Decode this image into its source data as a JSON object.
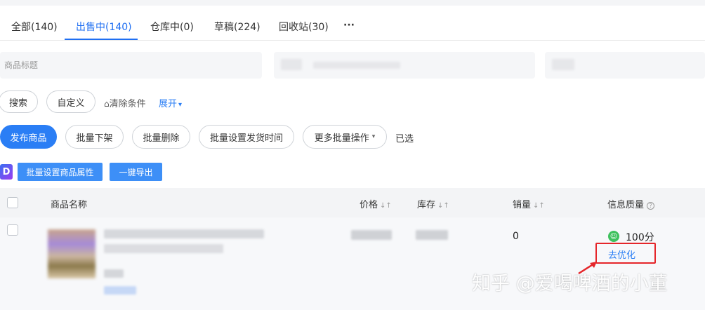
{
  "tabs": [
    {
      "label": "全部(140)"
    },
    {
      "label": "出售中(140)"
    },
    {
      "label": "仓库中(0)"
    },
    {
      "label": "草稿(224)"
    },
    {
      "label": "回收站(30)"
    },
    {
      "label": "···"
    }
  ],
  "filters": {
    "title_placeholder": "商品标题"
  },
  "search_row": {
    "search_label": "搜索",
    "custom_label": "自定义",
    "clear_label": "清除条件",
    "expand_label": "展开"
  },
  "actions": {
    "publish_label": "发布商品",
    "batch_delist_label": "批量下架",
    "batch_delete_label": "批量删除",
    "batch_ship_time_label": "批量设置发货时间",
    "more_batch_label": "更多批量操作",
    "selected_label": "已选"
  },
  "tools": {
    "logo_letter": "D",
    "batch_attr_label": "批量设置商品属性",
    "export_label": "一键导出"
  },
  "table": {
    "columns": {
      "name": "商品名称",
      "price": "价格",
      "stock": "库存",
      "sales": "销量",
      "quality": "信息质量"
    },
    "rows": [
      {
        "sales": "0",
        "score": "100分",
        "optimize": "去优化"
      }
    ]
  },
  "watermark": "知乎 @爱喝啤酒的小董",
  "colors": {
    "accent": "#2a7ef5",
    "highlight": "#e5262a",
    "good": "#3ec15d"
  }
}
